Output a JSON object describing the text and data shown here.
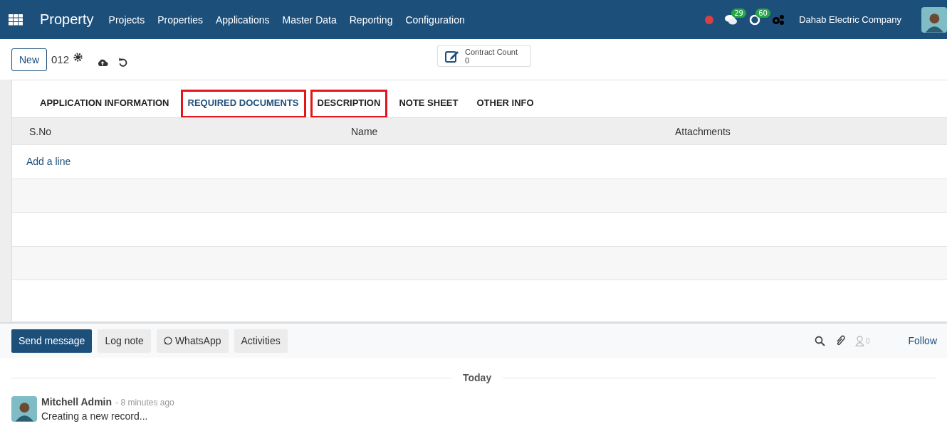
{
  "navbar": {
    "app_name": "Property",
    "menu": [
      "Projects",
      "Properties",
      "Applications",
      "Master Data",
      "Reporting",
      "Configuration"
    ],
    "messages_count": "29",
    "activities_count": "60",
    "company": "Dahab Electric Company"
  },
  "control_panel": {
    "new_button": "New",
    "record_name": "012",
    "smart_button": {
      "label": "Contract Count",
      "value": "0"
    }
  },
  "tabs": [
    {
      "label": "APPLICATION INFORMATION",
      "selected": false,
      "highlighted": false
    },
    {
      "label": "REQUIRED DOCUMENTS",
      "selected": true,
      "highlighted": true
    },
    {
      "label": "DESCRIPTION",
      "selected": false,
      "highlighted": true
    },
    {
      "label": "NOTE SHEET",
      "selected": false,
      "highlighted": false
    },
    {
      "label": "OTHER INFO",
      "selected": false,
      "highlighted": false
    }
  ],
  "table": {
    "columns": [
      "S.No",
      "Name",
      "Attachments"
    ],
    "add_line": "Add a line"
  },
  "chatter": {
    "buttons": [
      {
        "label": "Send message",
        "selected": true,
        "kind": "plain"
      },
      {
        "label": "Log note",
        "selected": false,
        "kind": "plain"
      },
      {
        "label": "WhatsApp",
        "selected": false,
        "kind": "whatsapp"
      },
      {
        "label": "Activities",
        "selected": false,
        "kind": "plain"
      }
    ],
    "followers_count": "0",
    "follow": "Follow",
    "date_separator": "Today",
    "messages": [
      {
        "author": "Mitchell Admin",
        "time": "- 8 minutes ago",
        "body": "Creating a new record..."
      }
    ]
  }
}
